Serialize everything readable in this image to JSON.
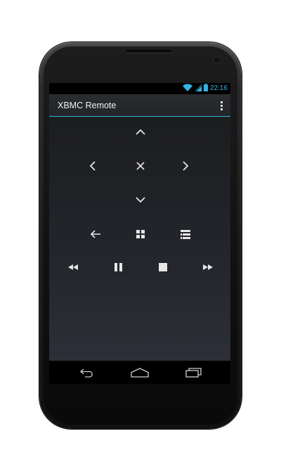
{
  "status_bar": {
    "time": "22:16",
    "icons": [
      "wifi-icon",
      "signal-icon",
      "battery-icon"
    ],
    "accent_color": "#33b5e5"
  },
  "action_bar": {
    "title": "XBMC Remote",
    "overflow_icon": "overflow-menu-icon",
    "divider_color": "#33b5e5"
  },
  "remote": {
    "dpad": [
      "up-arrow-icon",
      "left-arrow-icon",
      "select-x-icon",
      "right-arrow-icon",
      "down-arrow-icon"
    ],
    "secondary": [
      "back-arrow-icon",
      "home-grid-icon",
      "menu-list-icon"
    ],
    "transport": [
      "rewind-icon",
      "pause-icon",
      "stop-icon",
      "fast-forward-icon"
    ],
    "icon_color": "#e6e6e6"
  },
  "nav_bar": {
    "buttons": [
      "nav-back-icon",
      "nav-home-icon",
      "nav-recents-icon"
    ]
  }
}
